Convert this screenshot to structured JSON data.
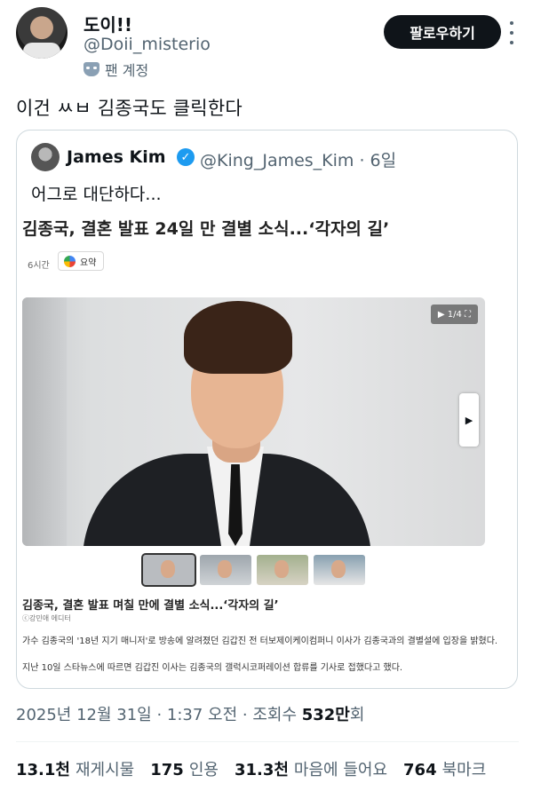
{
  "user": {
    "display_name": "도이!!",
    "handle": "@Doii_misterio",
    "fan_label": "팬 계정",
    "follow_label": "팔로우하기"
  },
  "tweet": {
    "text": "이건 ㅆㅂ 김종국도 클릭한다"
  },
  "quoted": {
    "name": "James Kim",
    "verified_mark": "✓",
    "handle_time": "@King_James_Kim · 6일",
    "text": "어그로 대단하다...",
    "article": {
      "title": "김종국, 결혼 발표 24일 만 결별 소식...‘각자의 길’",
      "time": "6시간",
      "summary_label": "요약",
      "gallery_counter": "▶ 1/4 ⛶",
      "next_label": "▶",
      "subtitle": "김종국, 결혼 발표 며칠 만에 결별 소식...‘각자의 길’",
      "author": "ⓒ강민애 에디터",
      "para1": "가수 김종국의 '18년 지기 매니저'로 방송에 알려졌던 김갑진 전 터보제이케이컴퍼니 이사가 김종국과의 결별설에 입장을 밝혔다.",
      "para2": "지난 10일 스타뉴스에 따르면 김갑진 이사는 김종국의 갤럭시코퍼레이션 합류를 기사로 접했다고 했다."
    }
  },
  "meta": {
    "datetime": "2025년 12월 31일 · 1:37 오전 · 조회수 ",
    "views_value": "532만",
    "views_suffix": "회"
  },
  "stats": {
    "reposts_value": "13.1천",
    "reposts_label": "재게시물",
    "quotes_value": "175",
    "quotes_label": "인용",
    "likes_value": "31.3천",
    "likes_label": "마음에 들어요",
    "bookmarks_value": "764",
    "bookmarks_label": "북마크"
  }
}
